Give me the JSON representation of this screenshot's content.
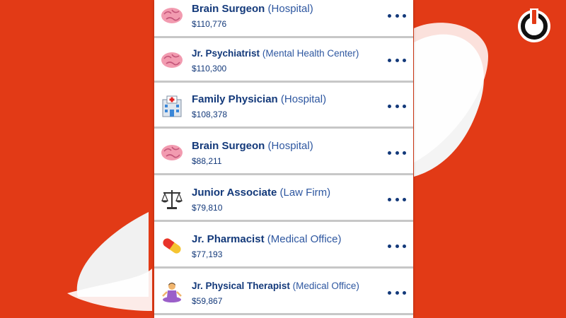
{
  "jobs": [
    {
      "title": "Brain Surgeon",
      "employer": "(Hospital)",
      "salary": "$110,776",
      "icon": "brain-icon"
    },
    {
      "title": "Jr. Psychiatrist",
      "employer": "(Mental Health Center)",
      "salary": "$110,300",
      "icon": "brain-icon"
    },
    {
      "title": "Family Physician",
      "employer": "(Hospital)",
      "salary": "$108,378",
      "icon": "hospital-icon"
    },
    {
      "title": "Brain Surgeon",
      "employer": "(Hospital)",
      "salary": "$88,211",
      "icon": "brain-icon"
    },
    {
      "title": "Junior Associate",
      "employer": "(Law Firm)",
      "salary": "$79,810",
      "icon": "scales-icon"
    },
    {
      "title": "Jr. Pharmacist",
      "employer": "(Medical Office)",
      "salary": "$77,193",
      "icon": "pill-icon"
    },
    {
      "title": "Jr. Physical Therapist",
      "employer": "(Medical Office)",
      "salary": "$59,867",
      "icon": "meditation-person-icon"
    }
  ],
  "colors": {
    "background": "#e23a16",
    "text_primary": "#13397a",
    "text_secondary": "#2e57a0",
    "separator": "#c7c7c7"
  }
}
